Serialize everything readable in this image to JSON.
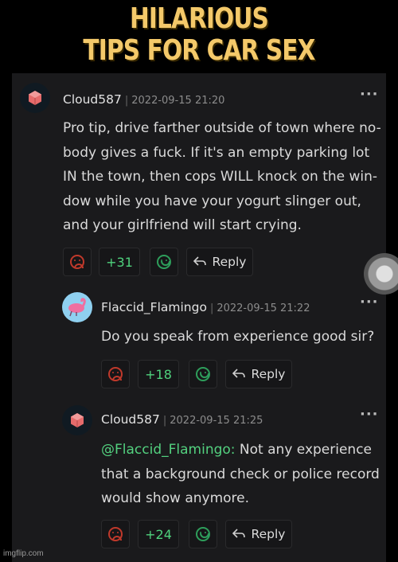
{
  "banner": {
    "line1": "HILARIOUS",
    "line2": "TIPS FOR CAR SEX"
  },
  "comments": [
    {
      "username": "Cloud587",
      "separator": "|",
      "timestamp": "2022-09-15 21:20",
      "menu": "···",
      "lines": [
        "Pro tip, drive farther outside of town where no-",
        "body gives a fuck. If it's an empty parking lot",
        "IN the town, then cops WILL knock on the win-",
        "dow while you have your yogurt slinger out,",
        "and your girlfriend will start crying."
      ],
      "score": "+31",
      "reply_label": "Reply"
    },
    {
      "username": "Flaccid_Flamingo",
      "separator": "|",
      "timestamp": "2022-09-15 21:22",
      "menu": "···",
      "lines": [
        "Do you speak from experience good sir?"
      ],
      "score": "+18",
      "reply_label": "Reply"
    },
    {
      "username": "Cloud587",
      "separator": "|",
      "timestamp": "2022-09-15 21:25",
      "menu": "···",
      "mention": "@Flaccid_Flamingo:",
      "lines": [
        " Not any experience",
        "that a background check or police record",
        "would show anymore."
      ],
      "score": "+24",
      "reply_label": "Reply"
    }
  ],
  "watermark": "imgflip.com",
  "colors": {
    "accent_green": "#4fd27d",
    "downvote_red": "#c0392b",
    "banner_yellow": "#f4c96a"
  }
}
